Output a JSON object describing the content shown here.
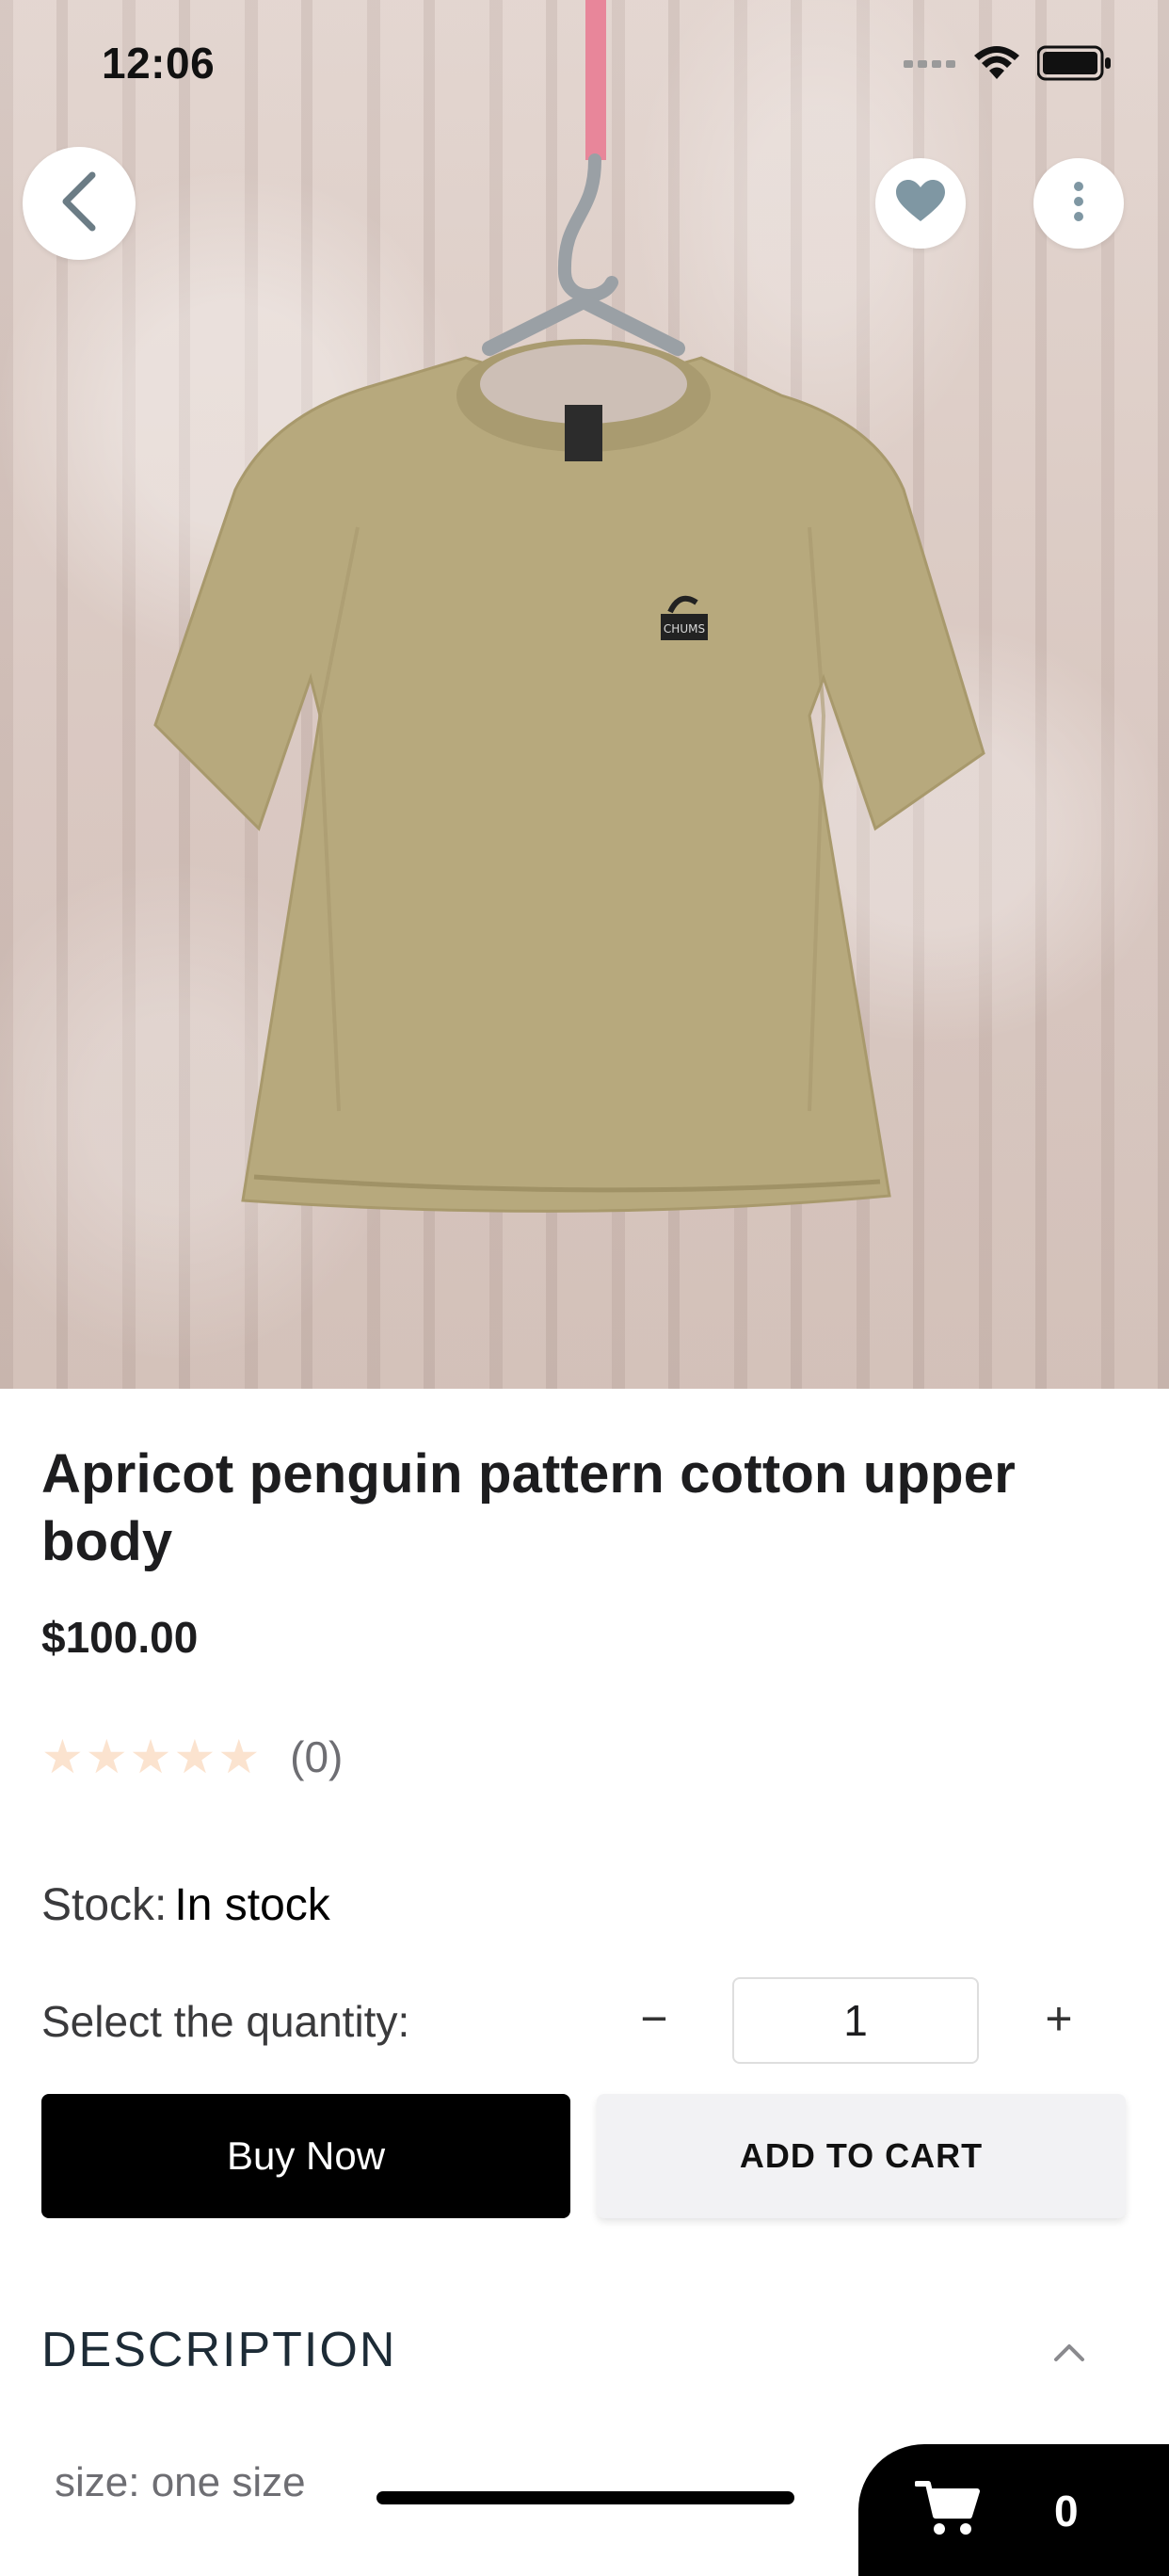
{
  "status_bar": {
    "time": "12:06"
  },
  "header": {
    "back_icon": "chevron-left-icon",
    "favorite_icon": "heart-icon",
    "more_icon": "more-vertical-icon"
  },
  "product": {
    "title": "Apricot penguin pattern cotton upper body",
    "price": "$100.00",
    "rating": {
      "stars": 0,
      "max": 5,
      "count_label": "(0)"
    },
    "stock_label": "Stock:",
    "stock_value": "In stock",
    "quantity_label": "Select the quantity:",
    "quantity_value": "1",
    "quantity_minus": "−",
    "quantity_plus": "+",
    "garment_label": "CHUMS"
  },
  "actions": {
    "buy_now": "Buy Now",
    "add_to_cart": "ADD TO CART"
  },
  "description": {
    "heading": "DESCRIPTION",
    "text": "size: one size"
  },
  "floating_cart": {
    "count": "0"
  },
  "colors": {
    "star_empty": "#fbe3cf",
    "shirt": "#b8aa80",
    "cart_bg": "#000000"
  }
}
